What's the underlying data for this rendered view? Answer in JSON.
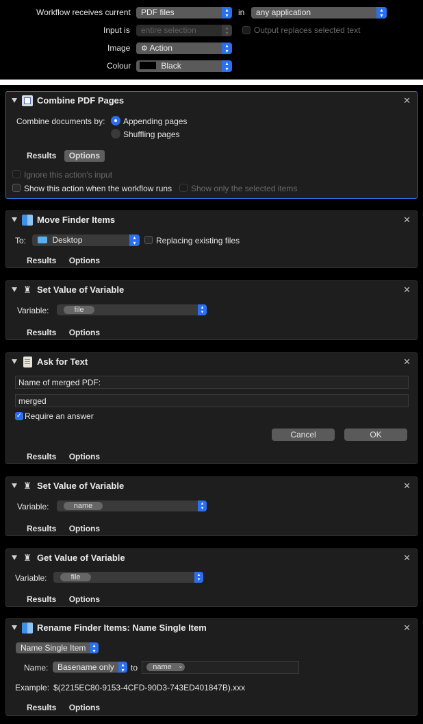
{
  "header": {
    "workflow_receives_label": "Workflow receives current",
    "receives_value": "PDF files",
    "in_label": "in",
    "in_value": "any application",
    "input_is_label": "Input is",
    "input_is_value": "entire selection",
    "output_replaces_label": "Output replaces selected text",
    "image_label": "Image",
    "image_value": "Action",
    "colour_label": "Colour",
    "colour_value": "Black"
  },
  "tabs": {
    "results": "Results",
    "options": "Options"
  },
  "actions": {
    "combine": {
      "title": "Combine PDF Pages",
      "combine_by_label": "Combine documents by:",
      "option_append": "Appending pages",
      "option_shuffle": "Shuffling pages",
      "ignore_input": "Ignore this action's input",
      "show_action": "Show this action when the workflow runs",
      "show_selected": "Show only the selected items"
    },
    "move": {
      "title": "Move Finder Items",
      "to_label": "To:",
      "to_value": "Desktop",
      "replace_label": "Replacing existing files"
    },
    "set1": {
      "title": "Set Value of Variable",
      "variable_label": "Variable:",
      "variable_value": "file"
    },
    "ask": {
      "title": "Ask for Text",
      "prompt_value": "Name of merged PDF:",
      "answer_value": "merged",
      "require_label": "Require an answer",
      "cancel": "Cancel",
      "ok": "OK"
    },
    "set2": {
      "title": "Set Value of Variable",
      "variable_label": "Variable:",
      "variable_value": "name"
    },
    "get": {
      "title": "Get Value of Variable",
      "variable_label": "Variable:",
      "variable_value": "file"
    },
    "rename": {
      "title": "Rename Finder Items: Name Single Item",
      "mode_value": "Name Single Item",
      "name_label": "Name:",
      "name_mode": "Basename only",
      "to_label": "to",
      "name_token": "name",
      "example_label": "Example:",
      "example_value": "$(2215EC80-9153-4CFD-90D3-743ED401847B).xxx"
    }
  },
  "colors": {
    "accent": "#2a6ff0",
    "selected_border": "#2f6fe0"
  }
}
